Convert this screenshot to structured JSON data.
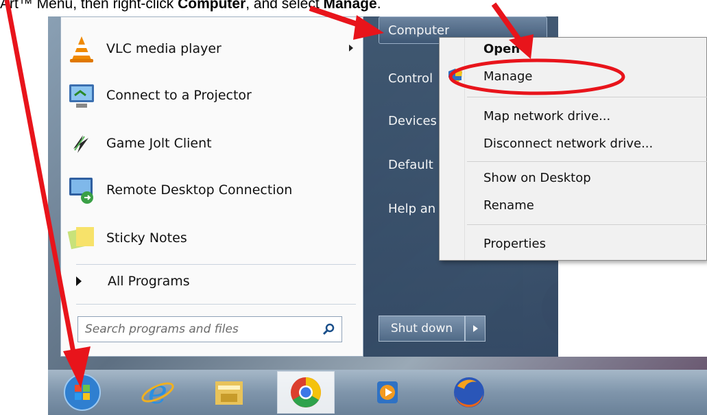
{
  "caption": {
    "part1": "Art™ Menu, then right-click ",
    "part2": "Computer",
    "part3": ", and select ",
    "part4": "Manage",
    "part5": "."
  },
  "start_menu": {
    "programs": [
      {
        "label": "VLC media player",
        "icon": "vlc-icon",
        "has_submenu": true
      },
      {
        "label": "Connect to a Projector",
        "icon": "projector-icon",
        "has_submenu": false
      },
      {
        "label": "Game Jolt Client",
        "icon": "gamejolt-icon",
        "has_submenu": false
      },
      {
        "label": "Remote Desktop Connection",
        "icon": "remote-desktop-icon",
        "has_submenu": false
      },
      {
        "label": "Sticky Notes",
        "icon": "sticky-notes-icon",
        "has_submenu": false
      }
    ],
    "all_programs": "All Programs",
    "search_placeholder": "Search programs and files",
    "right_items": [
      "Computer",
      "Control",
      "Devices",
      "Default",
      "Help an"
    ],
    "shutdown_label": "Shut down"
  },
  "context_menu": {
    "items": [
      {
        "label": "Open",
        "bold": true
      },
      {
        "label": "Manage",
        "bold": false,
        "highlighted": true
      },
      {
        "label": "Map network drive...",
        "bold": false
      },
      {
        "label": "Disconnect network drive...",
        "bold": false
      },
      {
        "label": "Show on Desktop",
        "bold": false
      },
      {
        "label": "Rename",
        "bold": false
      },
      {
        "label": "Properties",
        "bold": false
      }
    ]
  },
  "taskbar": {
    "items": [
      "start-orb-icon",
      "internet-explorer-icon",
      "file-explorer-icon",
      "chrome-icon",
      "media-player-icon",
      "firefox-icon"
    ]
  },
  "colors": {
    "annotation_red": "#e8141b",
    "start_right_pane": "#34506c"
  }
}
